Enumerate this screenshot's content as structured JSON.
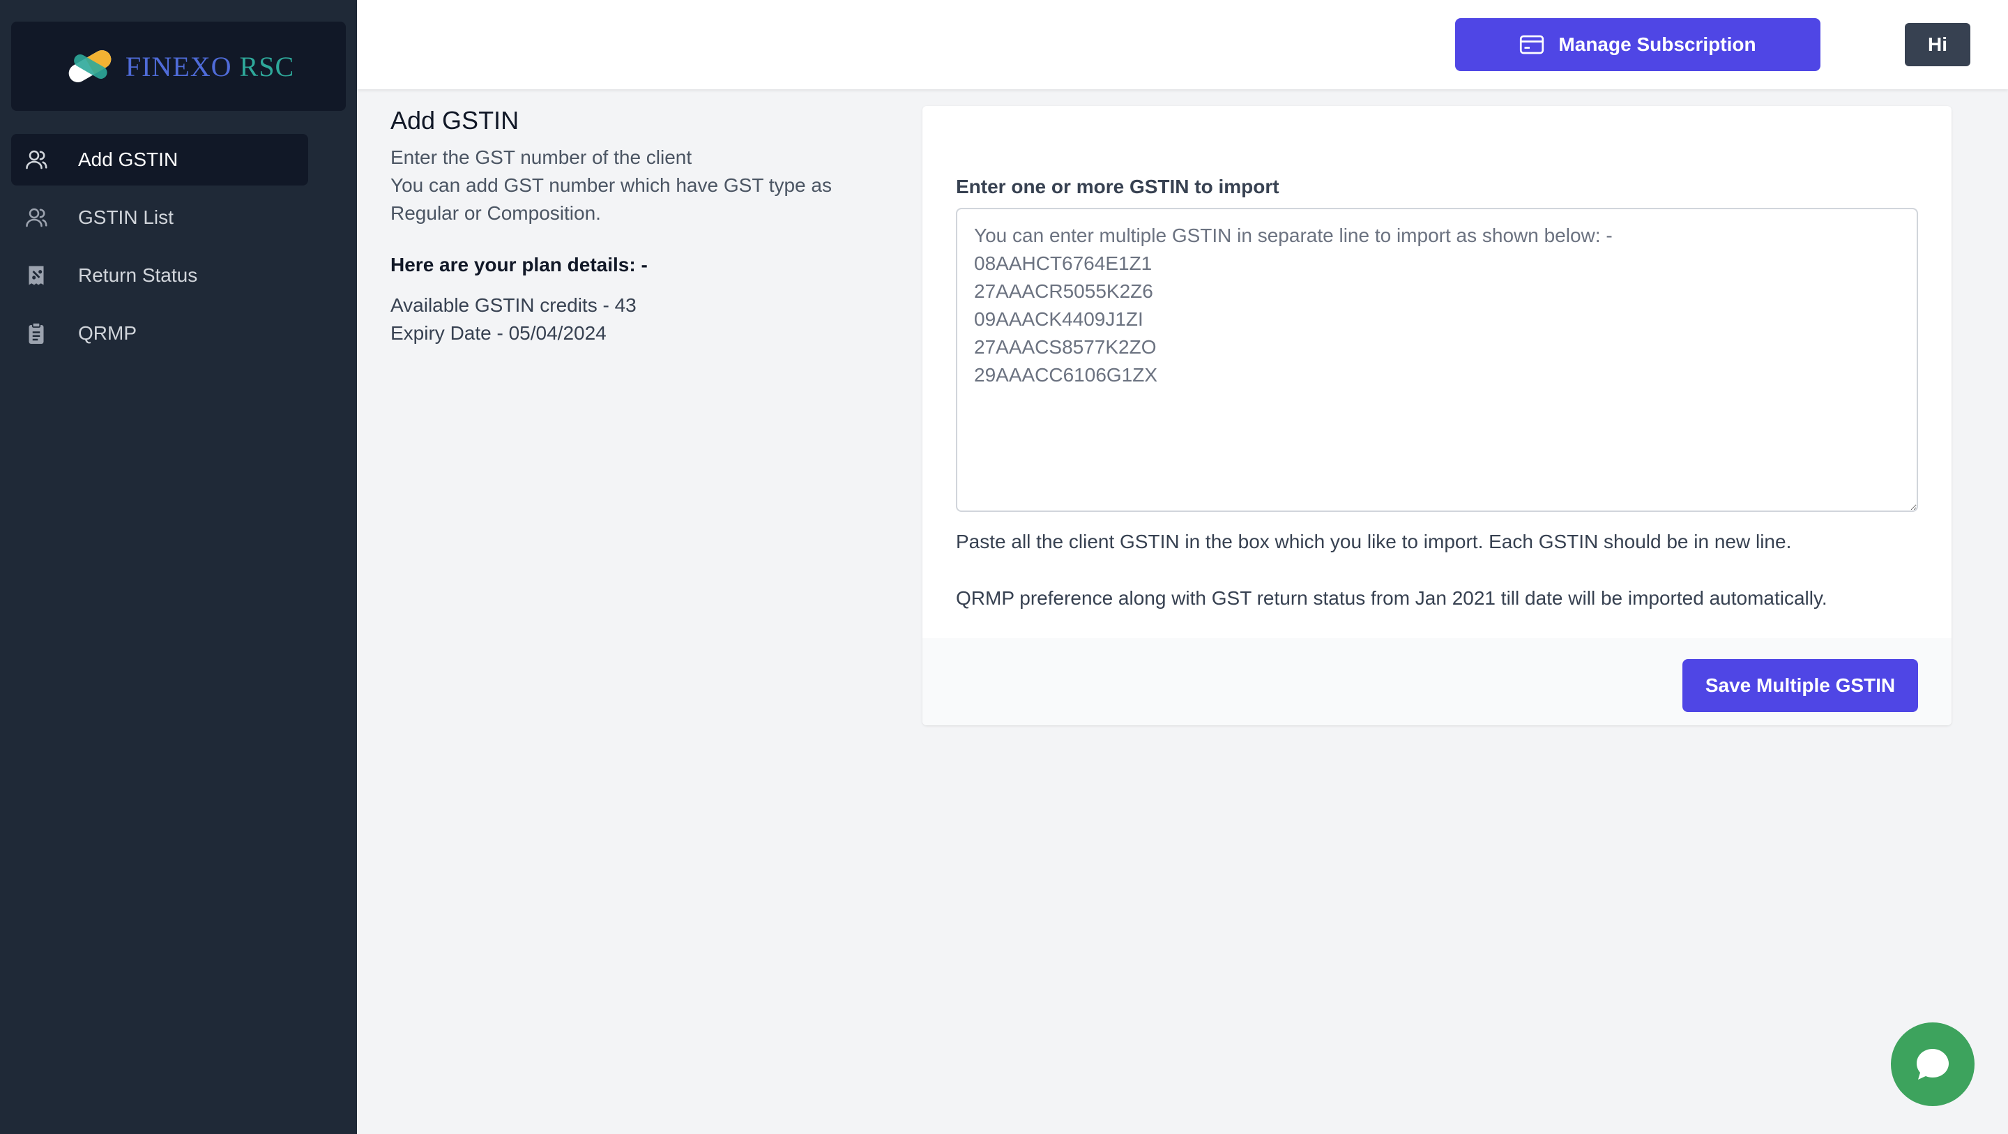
{
  "brand": {
    "name_part1": "FINEXO",
    "name_part2": "RSC"
  },
  "sidebar": {
    "items": [
      {
        "label": "Add GSTIN",
        "icon": "users-icon",
        "active": true
      },
      {
        "label": "GSTIN List",
        "icon": "users-icon",
        "active": false
      },
      {
        "label": "Return Status",
        "icon": "receipt-icon",
        "active": false
      },
      {
        "label": "QRMP",
        "icon": "clipboard-icon",
        "active": false
      }
    ]
  },
  "header": {
    "manage_subscription_label": "Manage Subscription",
    "user_label": "Hi"
  },
  "info": {
    "title": "Add GSTIN",
    "description_line1": "Enter the GST number of the client",
    "description_line2": "You can add GST number which have GST type as Regular or Composition.",
    "plan_heading": "Here are your plan details: -",
    "credits": "Available GSTIN credits - 43",
    "expiry": "Expiry Date - 05/04/2024"
  },
  "form": {
    "label": "Enter one or more GSTIN to import",
    "placeholder": "You can enter multiple GSTIN in separate line to import as shown below: -\n08AAHCT6764E1Z1\n27AAACR5055K2Z6\n09AAACK4409J1ZI\n27AAACS8577K2ZO\n29AAACC6106G1ZX",
    "help1": "Paste all the client GSTIN in the box which you like to import. Each GSTIN should be in new line.",
    "help2": "QRMP preference along with GST return status from Jan 2021 till date will be imported automatically.",
    "save_label": "Save Multiple GSTIN"
  },
  "colors": {
    "sidebar_bg": "#1f2937",
    "accent": "#4f46e5",
    "chat": "#3da35d"
  }
}
